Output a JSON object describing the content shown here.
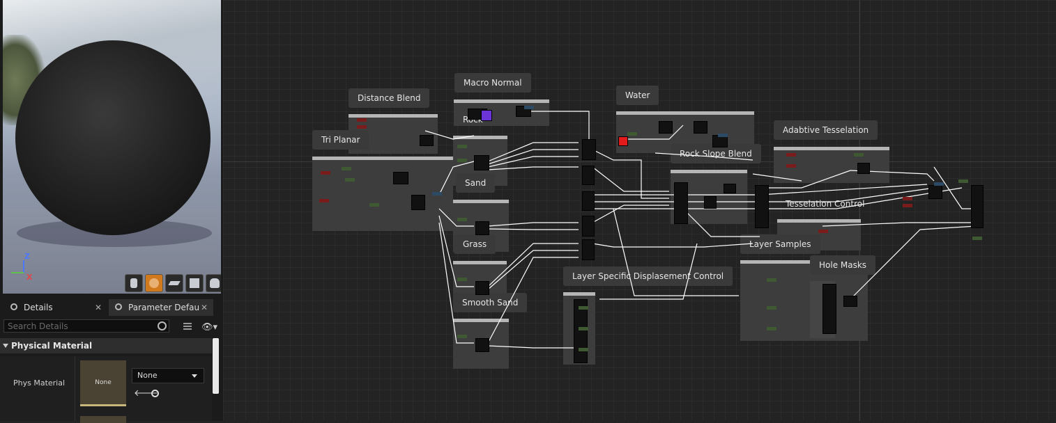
{
  "viewport": {
    "axes": {
      "z": "Z",
      "x": "X"
    },
    "toolbar": [
      {
        "name": "cylinder-preview-icon"
      },
      {
        "name": "sphere-preview-icon",
        "active": true
      },
      {
        "name": "plane-preview-icon"
      },
      {
        "name": "cube-preview-icon"
      },
      {
        "name": "custom-mesh-preview-icon"
      }
    ]
  },
  "tabs": [
    {
      "label": "Details",
      "close": "✕"
    },
    {
      "label": "Parameter Defaults",
      "close": "✕"
    }
  ],
  "details": {
    "search_placeholder": "Search Details",
    "section": "Physical Material",
    "property_label": "Phys Material",
    "thumbnail_text": "None",
    "combo_value": "None"
  },
  "graph": {
    "comments": [
      {
        "label": "Distance Blend"
      },
      {
        "label": "Macro Normal"
      },
      {
        "label": "Rock"
      },
      {
        "label": "Tri Planar"
      },
      {
        "label": "Sand"
      },
      {
        "label": "Grass"
      },
      {
        "label": "Smooth Sand"
      },
      {
        "label": "Water"
      },
      {
        "label": "Rock Slope Blend"
      },
      {
        "label": "Adabtive Tesselation"
      },
      {
        "label": "Tesselation Control"
      },
      {
        "label": "Layer Samples"
      },
      {
        "label": "Hole Masks"
      },
      {
        "label": "Layer Specific Displasement Control"
      }
    ],
    "colors": {
      "background": "#232323",
      "comment_body": "#3d3d3d",
      "comment_header": "#b5b5b5",
      "wire": "#ffffff",
      "pin_green": "#3f5a32",
      "pin_red": "#7a1c1c",
      "pin_blue": "#2c4a63"
    }
  }
}
